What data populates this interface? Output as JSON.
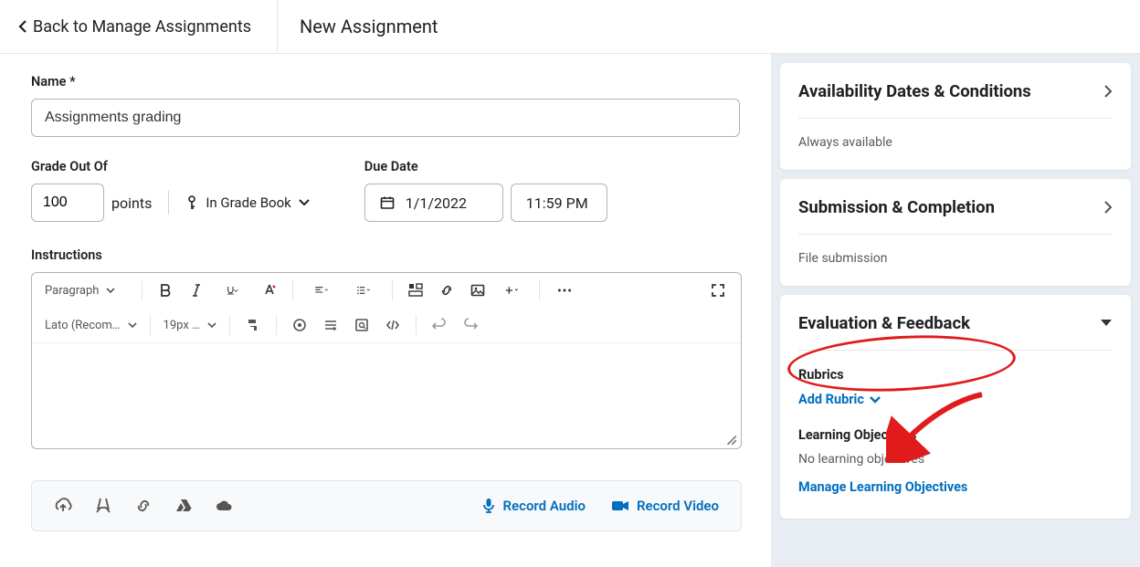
{
  "topbar": {
    "back_label": "Back to Manage Assignments",
    "page_title": "New Assignment"
  },
  "form": {
    "name_label": "Name",
    "name_required_mark": "*",
    "name_value": "Assignments grading",
    "grade_label": "Grade Out Of",
    "grade_value": "100",
    "points_label": "points",
    "grade_book_label": "In Grade Book",
    "due_label": "Due Date",
    "due_date": "1/1/2022",
    "due_time": "11:59 PM",
    "instructions_label": "Instructions",
    "editor": {
      "block_format": "Paragraph",
      "font_family": "Lato (Recom…",
      "font_size": "19px …"
    },
    "record_audio": "Record Audio",
    "record_video": "Record Video"
  },
  "sidebar": {
    "availability": {
      "title": "Availability Dates & Conditions",
      "subtitle": "Always available"
    },
    "submission": {
      "title": "Submission & Completion",
      "subtitle": "File submission"
    },
    "evaluation": {
      "title": "Evaluation & Feedback",
      "rubrics_heading": "Rubrics",
      "add_rubric": "Add Rubric",
      "learning_objectives_heading": "Learning Objectives",
      "learning_objectives_status": "No learning objectives",
      "manage_learning_objectives": "Manage Learning Objectives"
    }
  },
  "annotations": {
    "ellipse_target": "Evaluation & Feedback",
    "arrow_target": "Add Rubric"
  }
}
